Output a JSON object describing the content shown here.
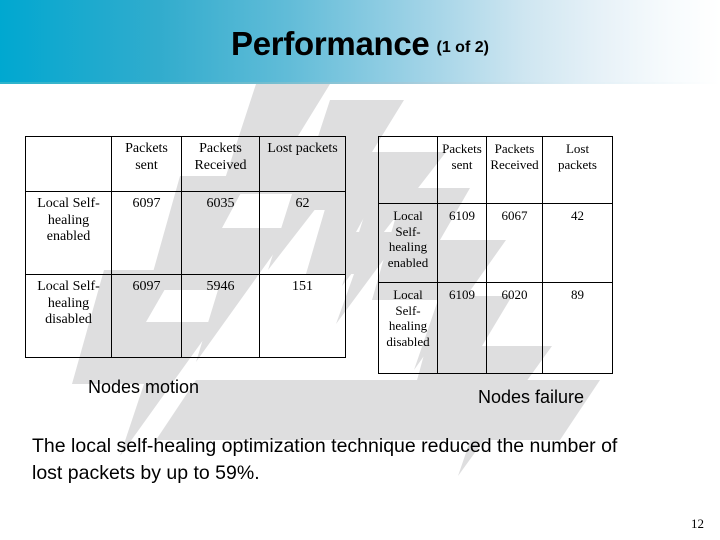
{
  "slide": {
    "title_main": "Performance",
    "title_sub": "(1 of 2)",
    "page_number": "12",
    "accent_color": "#00a8d0",
    "watermark_color": "#dededf",
    "text_color": "#000000"
  },
  "tables": {
    "left": {
      "caption": "Nodes motion",
      "headers": [
        "",
        "Packets sent",
        "Packets Received",
        "Lost packets"
      ],
      "rows": [
        {
          "label": "Local Self-healing enabled",
          "packets_sent": "6097",
          "packets_received": "6035",
          "lost_packets": "62"
        },
        {
          "label": "Local Self-healing disabled",
          "packets_sent": "6097",
          "packets_received": "5946",
          "lost_packets": "151"
        }
      ]
    },
    "right": {
      "caption": "Nodes failure",
      "headers": [
        "",
        "Packets sent",
        "Packets Received",
        "Lost packets"
      ],
      "rows": [
        {
          "label": "Local Self-healing enabled",
          "packets_sent": "6109",
          "packets_received": "6067",
          "lost_packets": "42"
        },
        {
          "label": "Local Self-healing disabled",
          "packets_sent": "6109",
          "packets_received": "6020",
          "lost_packets": "89"
        }
      ]
    }
  },
  "summary": {
    "text": "The local self-healing optimization technique reduced the number of lost packets by up to 59%."
  }
}
